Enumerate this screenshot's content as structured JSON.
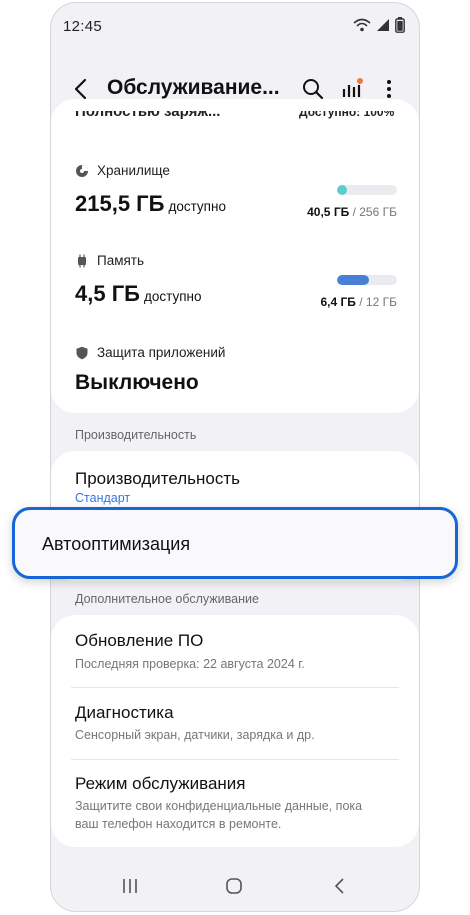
{
  "status_bar": {
    "time": "12:45"
  },
  "app_bar": {
    "title": "Обслуживание..."
  },
  "top_card": {
    "clipped_left": "Полностью заряж...",
    "clipped_right": "Доступно: 100%",
    "storage": {
      "label": "Хранилище",
      "value": "215,5 ГБ",
      "suffix": "доступно",
      "used": "40,5 ГБ",
      "total": "/ 256 ГБ",
      "fill_fraction": 0.16,
      "color": "#5ccccc"
    },
    "memory": {
      "label": "Память",
      "value": "4,5 ГБ",
      "suffix": "доступно",
      "used": "6,4 ГБ",
      "total": "/ 12 ГБ",
      "fill_fraction": 0.53,
      "color": "#4a7fd6"
    },
    "protection": {
      "label": "Защита приложений",
      "value": "Выключено"
    }
  },
  "performance_section": {
    "header": "Производительность",
    "item_title": "Производительность",
    "item_sub": "Стандарт",
    "auto_opt": "Автооптимизация"
  },
  "extra_section": {
    "header": "Дополнительное обслуживание",
    "items": [
      {
        "title": "Обновление ПО",
        "sub": "Последняя проверка: 22 августа 2024 г."
      },
      {
        "title": "Диагностика",
        "sub": "Сенсорный экран, датчики, зарядка и др."
      },
      {
        "title": "Режим обслуживания",
        "sub": "Защитите свои конфиденциальные данные, пока ваш телефон находится в ремонте."
      }
    ]
  },
  "colors": {
    "accent": "#1766d8",
    "link": "#3478d8",
    "notif_dot": "#f07a3a"
  }
}
